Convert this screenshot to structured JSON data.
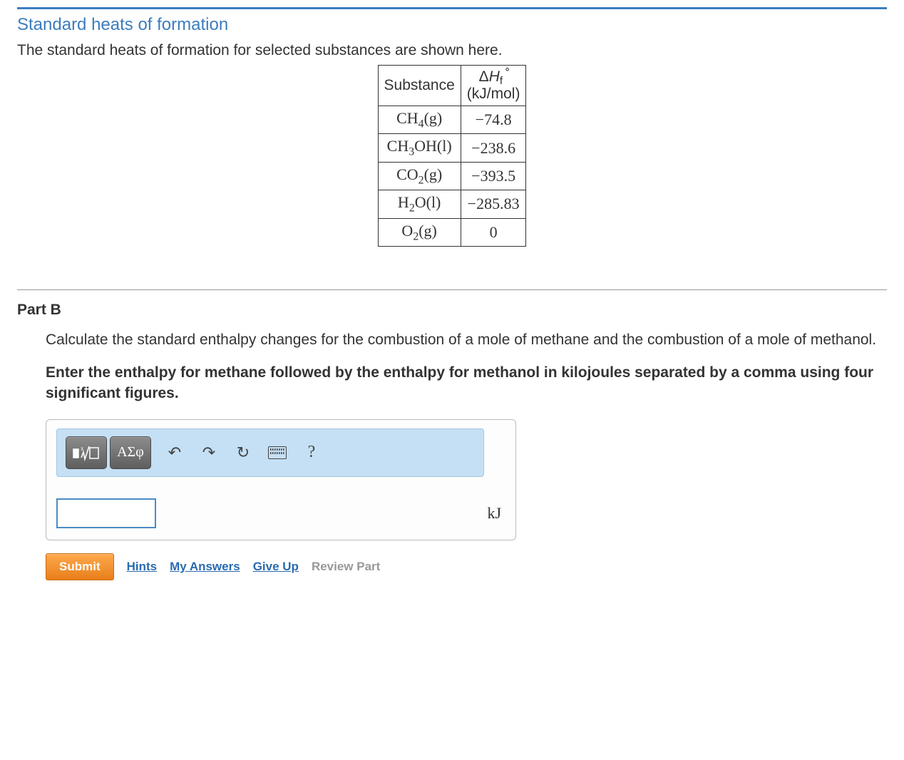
{
  "section_title": "Standard heats of formation",
  "intro": "The standard heats of formation for selected substances are shown here.",
  "table": {
    "headers": {
      "substance": "Substance",
      "value_html": "ΔH°_f (kJ/mol)"
    },
    "rows": [
      {
        "substance": "CH4(g)",
        "value": "−74.8"
      },
      {
        "substance": "CH3OH(l)",
        "value": "−238.6"
      },
      {
        "substance": "CO2(g)",
        "value": "−393.5"
      },
      {
        "substance": "H2O(l)",
        "value": "−285.83"
      },
      {
        "substance": "O2(g)",
        "value": "0"
      }
    ]
  },
  "part_label": "Part B",
  "question": "Calculate the standard enthalpy changes for the combustion of a mole of methane and the combustion of a mole of methanol.",
  "instruction": "Enter the enthalpy for methane followed by the enthalpy for methanol in kilojoules separated by a comma using four significant figures.",
  "toolbar": {
    "templates": "x√□",
    "greek": "ΑΣφ",
    "help": "?"
  },
  "unit": "kJ",
  "actions": {
    "submit": "Submit",
    "hints": "Hints",
    "my_answers": "My Answers",
    "give_up": "Give Up",
    "review": "Review Part"
  },
  "answer_value": ""
}
